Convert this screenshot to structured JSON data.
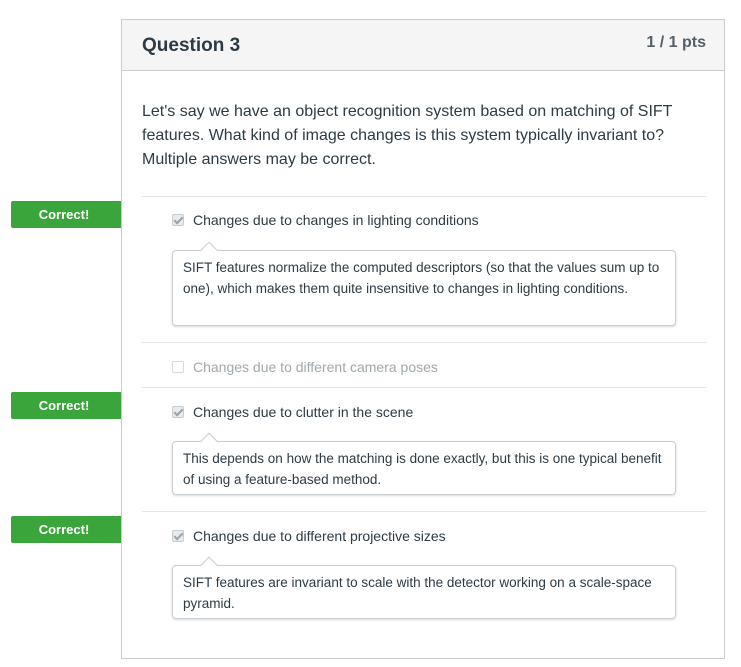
{
  "question": {
    "title": "Question 3",
    "points": "1 / 1 pts",
    "text": "Let's say we have an object recognition system based on matching of SIFT features. What kind of image changes is this system typically invariant to? Multiple answers may be correct."
  },
  "badge_label": "Correct!",
  "answers": [
    {
      "label": "Changes due to changes in lighting conditions",
      "checked": true,
      "correct": true,
      "comment": "SIFT features normalize the computed descriptors (so that the values sum up to one), which makes them quite insensitive to changes in lighting conditions."
    },
    {
      "label": "Changes due to different camera poses",
      "checked": false,
      "correct": false,
      "comment": ""
    },
    {
      "label": "Changes due to clutter in the scene",
      "checked": true,
      "correct": true,
      "comment": "This depends on how the matching is done exactly, but this is one typical benefit of using a feature-based method."
    },
    {
      "label": "Changes due to different projective sizes",
      "checked": true,
      "correct": true,
      "comment": "SIFT features are invariant to scale with the detector working on a scale-space pyramid."
    }
  ],
  "colors": {
    "correct_badge": "#3aa53a",
    "header_bg": "#f5f5f5",
    "border": "#c7cdd1"
  }
}
